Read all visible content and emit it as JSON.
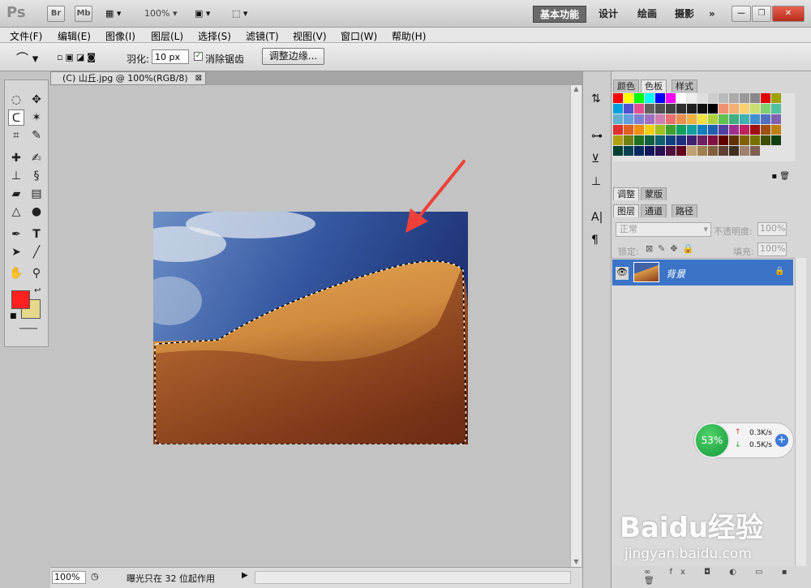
{
  "app": {
    "logo": "Ps",
    "bridge": "Br",
    "minibridge": "Mb",
    "zoom": "100%"
  },
  "workspaces": [
    "基本功能",
    "设计",
    "绘画",
    "摄影"
  ],
  "menus": [
    "文件(F)",
    "编辑(E)",
    "图像(I)",
    "图层(L)",
    "选择(S)",
    "滤镜(T)",
    "视图(V)",
    "窗口(W)",
    "帮助(H)"
  ],
  "options": {
    "feather_label": "羽化:",
    "feather_value": "10 px",
    "antialias_label": "消除锯齿",
    "refine_button": "调整边缘..."
  },
  "document": {
    "tab_title": "(C) 山丘.jpg @ 100%(RGB/8)"
  },
  "status": {
    "zoom": "100%",
    "message": "曝光只在 32 位起作用"
  },
  "swatch_panel": {
    "tabs": [
      "颜色",
      "色板",
      "样式"
    ]
  },
  "adjust_panel": {
    "tabs": [
      "调整",
      "蒙版"
    ]
  },
  "layers_panel": {
    "tabs": [
      "图层",
      "通道",
      "路径"
    ],
    "blend_mode": "正常",
    "opacity_label": "不透明度:",
    "opacity_value": "100%",
    "lock_label": "锁定:",
    "fill_label": "填充:",
    "fill_value": "100%",
    "layer_name": "背景"
  },
  "net_widget": {
    "cpu": "53%",
    "up": "0.3K/s",
    "down": "0.5K/s"
  },
  "watermark": {
    "brand": "Baidu经验",
    "url": "jingyan.baidu.com"
  },
  "colors": {
    "foreground": "#ff2020",
    "background": "#e6d88a",
    "accent": "#3b73c7"
  }
}
